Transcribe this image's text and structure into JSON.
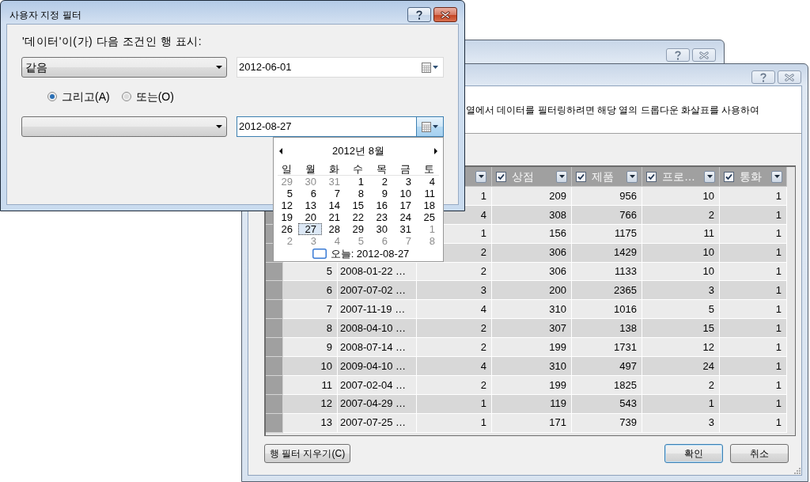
{
  "custom_filter_dialog": {
    "title": "사용자 지정 필터",
    "active": true,
    "prompt": "'데이터'이(가) 다음 조건인 행 표시:",
    "conditions": [
      {
        "operator": "같음",
        "value": "2012-06-01",
        "open": false
      },
      {
        "value": "2012-08-27",
        "open": true
      }
    ],
    "logic": [
      {
        "label": "그리고(A)",
        "selected": true
      },
      {
        "label": "또는(O)",
        "selected": false
      }
    ]
  },
  "calendar": {
    "title": "2012년 8월",
    "weekdays": [
      "일",
      "월",
      "화",
      "수",
      "목",
      "금",
      "토"
    ],
    "weeks": [
      [
        {
          "day": "29",
          "other_month": true,
          "selected": false
        },
        {
          "day": "30",
          "other_month": true,
          "selected": false
        },
        {
          "day": "31",
          "other_month": true,
          "selected": false
        },
        {
          "day": "1",
          "other_month": false,
          "selected": false
        },
        {
          "day": "2",
          "other_month": false,
          "selected": false
        },
        {
          "day": "3",
          "other_month": false,
          "selected": false
        },
        {
          "day": "4",
          "other_month": false,
          "selected": false
        }
      ],
      [
        {
          "day": "5",
          "other_month": false,
          "selected": false
        },
        {
          "day": "6",
          "other_month": false,
          "selected": false
        },
        {
          "day": "7",
          "other_month": false,
          "selected": false
        },
        {
          "day": "8",
          "other_month": false,
          "selected": false
        },
        {
          "day": "9",
          "other_month": false,
          "selected": false
        },
        {
          "day": "10",
          "other_month": false,
          "selected": false
        },
        {
          "day": "11",
          "other_month": false,
          "selected": false
        }
      ],
      [
        {
          "day": "12",
          "other_month": false,
          "selected": false
        },
        {
          "day": "13",
          "other_month": false,
          "selected": false
        },
        {
          "day": "14",
          "other_month": false,
          "selected": false
        },
        {
          "day": "15",
          "other_month": false,
          "selected": false
        },
        {
          "day": "16",
          "other_month": false,
          "selected": false
        },
        {
          "day": "17",
          "other_month": false,
          "selected": false
        },
        {
          "day": "18",
          "other_month": false,
          "selected": false
        }
      ],
      [
        {
          "day": "19",
          "other_month": false,
          "selected": false
        },
        {
          "day": "20",
          "other_month": false,
          "selected": false
        },
        {
          "day": "21",
          "other_month": false,
          "selected": false
        },
        {
          "day": "22",
          "other_month": false,
          "selected": false
        },
        {
          "day": "23",
          "other_month": false,
          "selected": false
        },
        {
          "day": "24",
          "other_month": false,
          "selected": false
        },
        {
          "day": "25",
          "other_month": false,
          "selected": false
        }
      ],
      [
        {
          "day": "26",
          "other_month": false,
          "selected": false
        },
        {
          "day": "27",
          "other_month": false,
          "selected": true
        },
        {
          "day": "28",
          "other_month": false,
          "selected": false
        },
        {
          "day": "29",
          "other_month": false,
          "selected": false
        },
        {
          "day": "30",
          "other_month": false,
          "selected": false
        },
        {
          "day": "31",
          "other_month": false,
          "selected": false
        },
        {
          "day": "1",
          "other_month": true,
          "selected": false
        }
      ],
      [
        {
          "day": "2",
          "other_month": true,
          "selected": false
        },
        {
          "day": "3",
          "other_month": true,
          "selected": false
        },
        {
          "day": "4",
          "other_month": true,
          "selected": false
        },
        {
          "day": "5",
          "other_month": true,
          "selected": false
        },
        {
          "day": "6",
          "other_month": true,
          "selected": false
        },
        {
          "day": "7",
          "other_month": true,
          "selected": false
        },
        {
          "day": "8",
          "other_month": true,
          "selected": false
        }
      ]
    ],
    "today": "오늘: 2012-08-27"
  },
  "background_window": {
    "active": false
  },
  "row_filter_window": {
    "active": false,
    "instructions": "열에서 데이터를 필터링하려면 해당 열의 드롭다운 화살표를 사용하여",
    "table": {
      "columns": [
        {
          "label": "상점",
          "checked": true
        },
        {
          "label": "제품",
          "checked": true
        },
        {
          "label": "프로…",
          "checked": true
        },
        {
          "label": "통화",
          "checked": true
        }
      ],
      "rows": [
        {
          "values": [
            "1",
            "209",
            "956",
            "10",
            "1"
          ]
        },
        {
          "values": [
            "4",
            "308",
            "766",
            "2",
            "1"
          ]
        },
        {
          "values": [
            "1",
            "156",
            "1175",
            "11",
            "1"
          ]
        },
        {
          "values": [
            "2",
            "306",
            "1429",
            "10",
            "1"
          ]
        },
        {
          "row_number": "5",
          "column_2": "2008-01-22 …",
          "values": [
            "2",
            "306",
            "1133",
            "10",
            "1"
          ]
        },
        {
          "row_number": "6",
          "column_2": "2007-07-02 …",
          "values": [
            "3",
            "200",
            "2365",
            "3",
            "1"
          ]
        },
        {
          "row_number": "7",
          "column_2": "2007-11-19 …",
          "values": [
            "4",
            "310",
            "1016",
            "5",
            "1"
          ]
        },
        {
          "row_number": "8",
          "column_2": "2008-04-10 …",
          "values": [
            "2",
            "307",
            "138",
            "15",
            "1"
          ]
        },
        {
          "row_number": "9",
          "column_2": "2008-07-14 …",
          "values": [
            "2",
            "199",
            "1731",
            "12",
            "1"
          ]
        },
        {
          "row_number": "10",
          "column_2": "2009-04-10 …",
          "values": [
            "4",
            "310",
            "497",
            "24",
            "1"
          ]
        },
        {
          "row_number": "11",
          "column_2": "2007-02-04 …",
          "values": [
            "2",
            "199",
            "1825",
            "2",
            "1"
          ]
        },
        {
          "row_number": "12",
          "column_2": "2007-04-29 …",
          "values": [
            "1",
            "119",
            "543",
            "1",
            "1"
          ]
        },
        {
          "row_number": "13",
          "column_2": "2007-07-25 …",
          "values": [
            "1",
            "171",
            "739",
            "3",
            "1"
          ]
        }
      ]
    },
    "buttons": [
      {
        "label": "행 필터 지우기(C)",
        "default": false
      },
      {
        "label": "확인",
        "default": true
      },
      {
        "label": "취소",
        "default": false
      }
    ]
  }
}
